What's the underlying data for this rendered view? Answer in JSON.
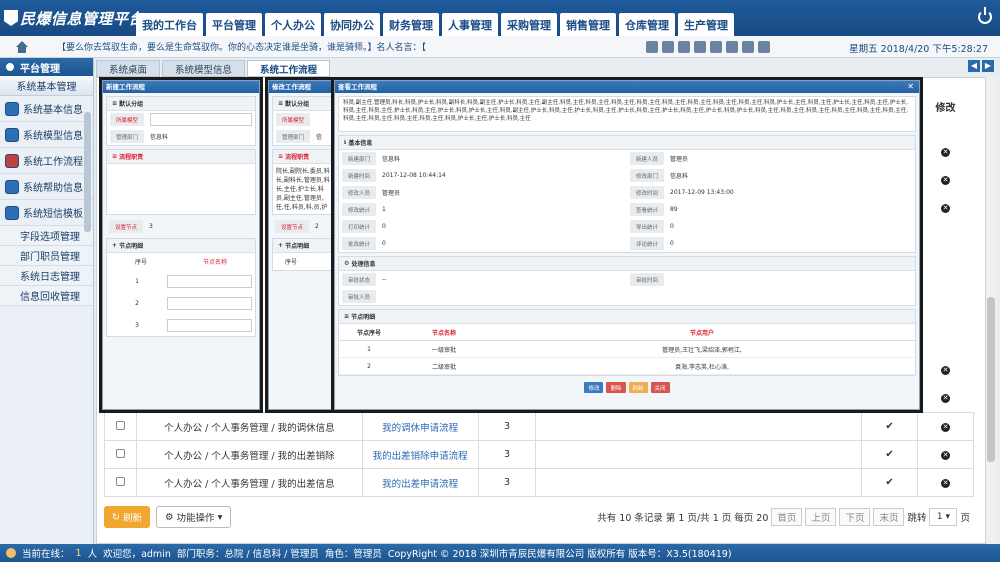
{
  "app": {
    "title": "民爆信息管理平台"
  },
  "topnav": [
    "我的工作台",
    "平台管理",
    "个人办公",
    "协同办公",
    "财务管理",
    "人事管理",
    "采购管理",
    "销售管理",
    "仓库管理",
    "生产管理"
  ],
  "subbar": {
    "marquee": "【要么你去驾驭生命，要么是生命驾驭你。你的心态决定谁是坐骑，谁是骑师。】名人名言：【",
    "datetime": "星期五    2018/4/20 下午5:28:27"
  },
  "sidebar": {
    "header": "平台管理",
    "section": "系统基本管理",
    "items": [
      "系统基本信息",
      "系统模型信息",
      "系统工作流程",
      "系统帮助信息",
      "系统短信模板"
    ],
    "subitems": [
      "字段选项管理",
      "部门职员管理",
      "系统日志管理",
      "信息回收管理"
    ]
  },
  "tabs": [
    "系统桌面",
    "系统模型信息",
    "系统工作流程"
  ],
  "grid": {
    "column_header": "修改",
    "rows": [
      {
        "path": "个人办公 / 个人事务管理 / 我的调休信息",
        "link": "我的调休申请流程",
        "nodes": "3"
      },
      {
        "path": "个人办公 / 个人事务管理 / 我的出差销除",
        "link": "我的出差销除申请流程",
        "nodes": "3"
      },
      {
        "path": "个人办公 / 个人事务管理 / 我的出差信息",
        "link": "我的出差申请流程",
        "nodes": "3"
      }
    ]
  },
  "footer": {
    "refresh": "刷新",
    "actions": "功能操作",
    "pager_text": "共有 10 条记录 第 1 页/共 1 页 每页 20",
    "first": "首页",
    "prev": "上页",
    "next": "下页",
    "last": "末页",
    "jump": "跳转",
    "page": "1",
    "page_unit": "页"
  },
  "dialog1": {
    "title": "新建工作流程",
    "sec1": "默认分组",
    "label_model": "所属模型",
    "label_dept": "管理部门",
    "dept_val": "信息科",
    "sec2": "流程职责",
    "label_nodes": "设置节点",
    "nodes_val": "3",
    "sec3": "节点明细",
    "col_no": "序号",
    "col_name": "节点名称",
    "rows": [
      "1",
      "2",
      "3"
    ]
  },
  "dialog2": {
    "title": "修改工作流程",
    "sec1": "默认分组",
    "label_model": "所属模型",
    "label_dept": "管理部门",
    "dept_val": "信",
    "sec2": "流程职责",
    "text": "院长,副院长,委员,科长,副科长,管理员,科长,主任,护士长,科员,副主任,管理员,任,任,科员,科,员,护士长",
    "label_nodes": "设置节点",
    "nodes_val": "2",
    "sec3": "节点明细",
    "col_no": "序号"
  },
  "dialog3": {
    "title": "查看工作流程",
    "roles_text": "科员,副主任,管理员,科长,科员,护士长,科员,副科长,科员,副主任,护士长,科员,主任,副主任,科员,主任,科员,主任,科员,主任,科员,主任,科员,主任,科员,主任,科员,主任,科员,主任,科员,护士长,主任,科员,主任,护士长,主任,科员,主任,护士长,科员,主任,科员,主任,护士长,科员,主任,护士长,科员,护士长,主任,科员,副主任,护士长,科员,主任,护士长,科员,主任,护士长,科员,主任,护士长,科员,主任,护士长,科员,护士长,科员,主任,科员,主任,科员,主任,科员,主任,科员,主任,科员,主任,科员,主任,科员,主任,科员,主任,科员,主任,科员,护士长,主任,护士长,科员,主任",
    "sec_basic": "基本信息",
    "basic": [
      [
        "新建部门",
        "信息科",
        "新建人员",
        "管理员"
      ],
      [
        "新建时间",
        "2017-12-08 10:44:14",
        "修改部门",
        "信息科"
      ],
      [
        "修改人员",
        "管理员",
        "修改时间",
        "2017-12-09 13:43:00"
      ],
      [
        "修改统计",
        "1",
        "查看统计",
        "89"
      ],
      [
        "打印统计",
        "0",
        "导出统计",
        "0"
      ],
      [
        "批改统计",
        "0",
        "评论统计",
        "0"
      ]
    ],
    "sec_proc": "处理信息",
    "proc": [
      [
        "审批状态",
        "--",
        "审批时间",
        ""
      ],
      [
        "审批人员",
        "",
        "",
        ""
      ]
    ],
    "sec_nodes": "节点明细",
    "node_cols": [
      "节点序号",
      "节点名称",
      "节点用户"
    ],
    "node_rows": [
      [
        "1",
        "一级审批",
        "管理员,王壮飞,梁绍泽,郭柯江,"
      ],
      [
        "2",
        "二级审批",
        "袁海,李志英,杜心涛,"
      ]
    ],
    "buttons": [
      "修改",
      "删除",
      "刷新",
      "关闭"
    ],
    "btn_colors": [
      "#3a7ac0",
      "#d9534f",
      "#f0ad4e",
      "#d9534f"
    ]
  },
  "status": {
    "online_label": "当前在线：",
    "online": "1",
    "unit": "人",
    "welcome": "欢迎您，admin",
    "dept": "部门职务：总院 / 信息科 / 管理员",
    "role": "角色：管理员",
    "copyright": "CopyRight © 2018   深圳市青辰民爆有限公司 版权所有 版本号：X3.5(180419)"
  }
}
